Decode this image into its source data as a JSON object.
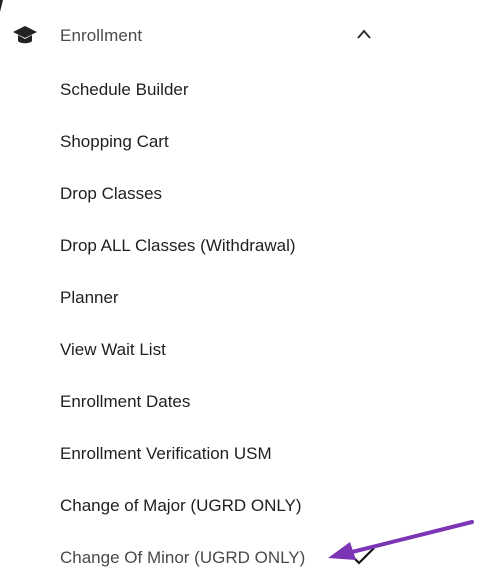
{
  "section": {
    "title": "Enrollment",
    "icon": "graduation-cap-icon",
    "expanded_icon": "chevron-up-icon"
  },
  "items": [
    {
      "label": "Schedule Builder"
    },
    {
      "label": "Shopping Cart"
    },
    {
      "label": "Drop Classes"
    },
    {
      "label": "Drop ALL Classes (Withdrawal)"
    },
    {
      "label": "Planner"
    },
    {
      "label": "View Wait List"
    },
    {
      "label": "Enrollment Dates"
    },
    {
      "label": "Enrollment Verification USM"
    },
    {
      "label": "Change of Major (UGRD ONLY)"
    },
    {
      "label": "Change Of Minor (UGRD ONLY)",
      "selected": true
    }
  ],
  "annotation": {
    "color": "#7b35b5"
  },
  "colors": {
    "header_text": "#4a4a4a",
    "item_text": "#1f1f1f"
  }
}
